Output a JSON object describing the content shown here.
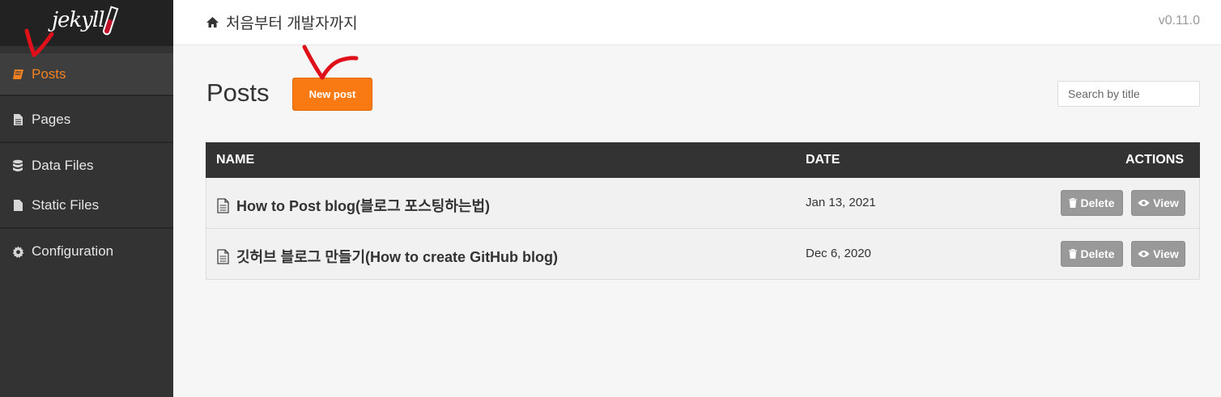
{
  "app": {
    "logo_text": "jekyll",
    "version": "v0.11.0"
  },
  "sidebar": {
    "items": [
      {
        "label": "Posts",
        "icon": "book-icon",
        "active": true
      },
      {
        "label": "Pages",
        "icon": "file-icon",
        "active": false
      },
      {
        "label": "Data Files",
        "icon": "database-icon",
        "active": false
      },
      {
        "label": "Static Files",
        "icon": "file-icon",
        "active": false
      },
      {
        "label": "Configuration",
        "icon": "gear-icon",
        "active": false
      }
    ]
  },
  "header": {
    "breadcrumb": "처음부터 개발자까지",
    "breadcrumb_icon": "home-icon"
  },
  "main": {
    "title": "Posts",
    "new_button": "New post",
    "search_placeholder": "Search by title"
  },
  "table": {
    "columns": {
      "name": "NAME",
      "date": "DATE",
      "actions": "ACTIONS"
    },
    "rows": [
      {
        "title": "How to Post blog(블로그 포스팅하는법)",
        "date": "Jan 13, 2021",
        "delete": "Delete",
        "view": "View"
      },
      {
        "title": "깃허브 블로그 만들기(How to create GitHub blog)",
        "date": "Dec 6, 2020",
        "delete": "Delete",
        "view": "View"
      }
    ]
  },
  "colors": {
    "accent": "#f97a12",
    "sidebar_bg": "#333333",
    "annotation": "#e0101a"
  }
}
